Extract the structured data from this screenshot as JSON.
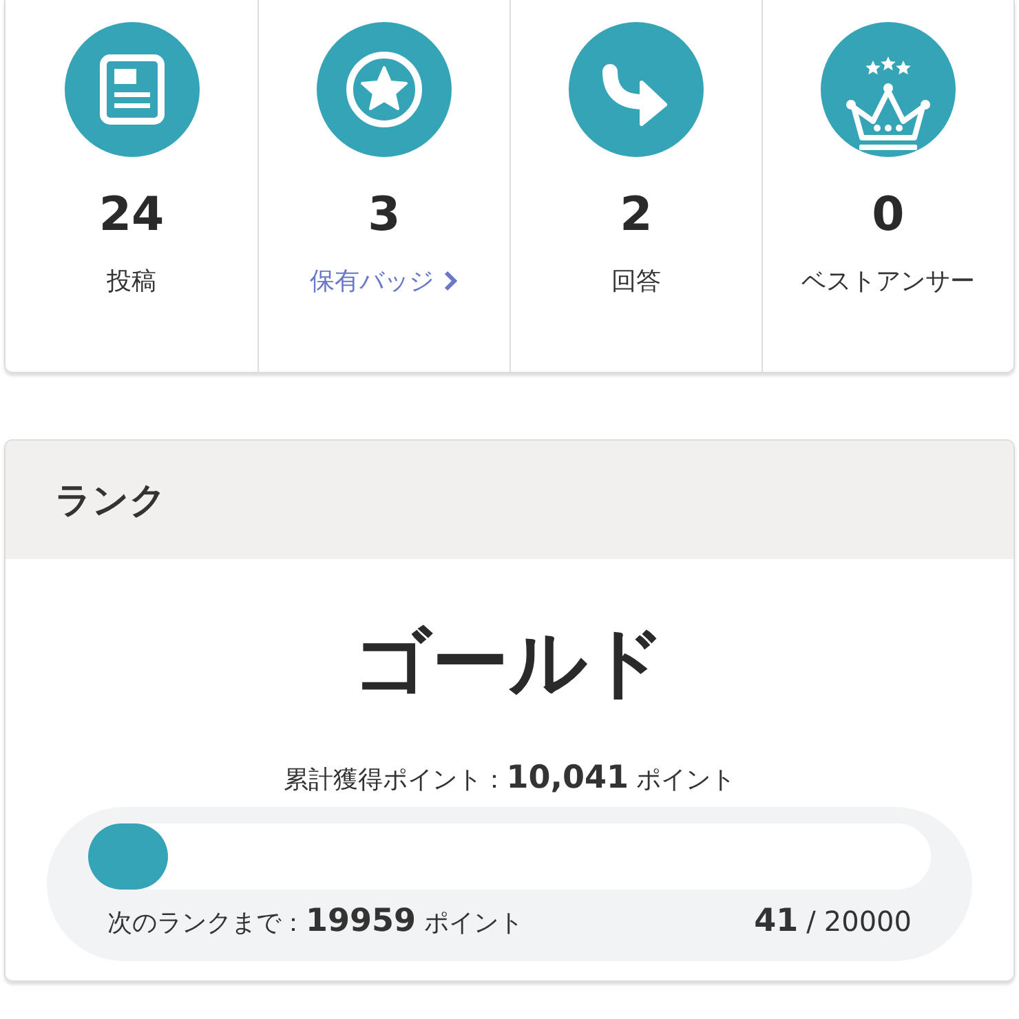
{
  "stats": [
    {
      "value": "24",
      "label": "投稿",
      "kind": "plain"
    },
    {
      "value": "3",
      "label": "保有バッジ",
      "kind": "link"
    },
    {
      "value": "2",
      "label": "回答",
      "kind": "plain"
    },
    {
      "value": "0",
      "label": "ベストアンサー",
      "kind": "plain"
    }
  ],
  "rank": {
    "title": "ランク",
    "name": "ゴールド",
    "total": "累計獲得ポイント：**10,041** ポイント",
    "progress": {
      "level": 0.002,
      "remaining": "次のランクまで：**19959** ポイント",
      "current": "41",
      "separator": "/",
      "target": "20000"
    }
  }
}
